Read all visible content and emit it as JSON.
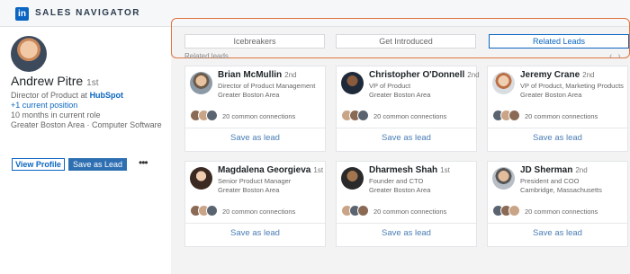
{
  "app": {
    "logo_text": "in",
    "title": "SALES NAVIGATOR"
  },
  "profile": {
    "name": "Andrew Pitre",
    "degree": "1st",
    "title_prefix": "Director of Product at",
    "company": "HubSpot",
    "current_position": "+1 current position",
    "tenure": "10 months in current role",
    "location": "Greater Boston Area",
    "industry": "Computer Software",
    "view_profile_label": "View Profile",
    "save_lead_label": "Save as Lead",
    "more_label": "•••"
  },
  "tabs": [
    {
      "label": "Icebreakers",
      "active": false
    },
    {
      "label": "Get Introduced",
      "active": false
    },
    {
      "label": "Related Leads",
      "active": true
    }
  ],
  "related_label": "Related leads",
  "nav": {
    "prev": "‹",
    "next": "›"
  },
  "leads": [
    {
      "name": "Brian McMullin",
      "degree": "2nd",
      "title": "Director of Product Management",
      "location": "Greater Boston Area",
      "connections": "20 common connections",
      "save_label": "Save as lead"
    },
    {
      "name": "Christopher O'Donnell",
      "degree": "2nd",
      "title": "VP of Product",
      "location": "Greater Boston Area",
      "connections": "20 common connections",
      "save_label": "Save as lead"
    },
    {
      "name": "Jeremy Crane",
      "degree": "2nd",
      "title": "VP of Product, Marketing Products",
      "location": "Greater Boston Area",
      "connections": "20 common connections",
      "save_label": "Save as lead"
    },
    {
      "name": "Magdalena Georgieva",
      "degree": "1st",
      "title": "Senior Product Manager",
      "location": "Greater Boston Area",
      "connections": "20 common connections",
      "save_label": "Save as lead"
    },
    {
      "name": "Dharmesh Shah",
      "degree": "1st",
      "title": "Founder and CTO",
      "location": "Greater Boston Area",
      "connections": "20 common connections",
      "save_label": "Save as lead"
    },
    {
      "name": "JD Sherman",
      "degree": "2nd",
      "title": "President and COO",
      "location": "Cambridge, Massachusetts",
      "connections": "20 common connections",
      "save_label": "Save as lead"
    }
  ],
  "colors": {
    "brand": "#0a66c2",
    "highlight_frame": "#e07440",
    "save_link": "#4a7db5"
  }
}
